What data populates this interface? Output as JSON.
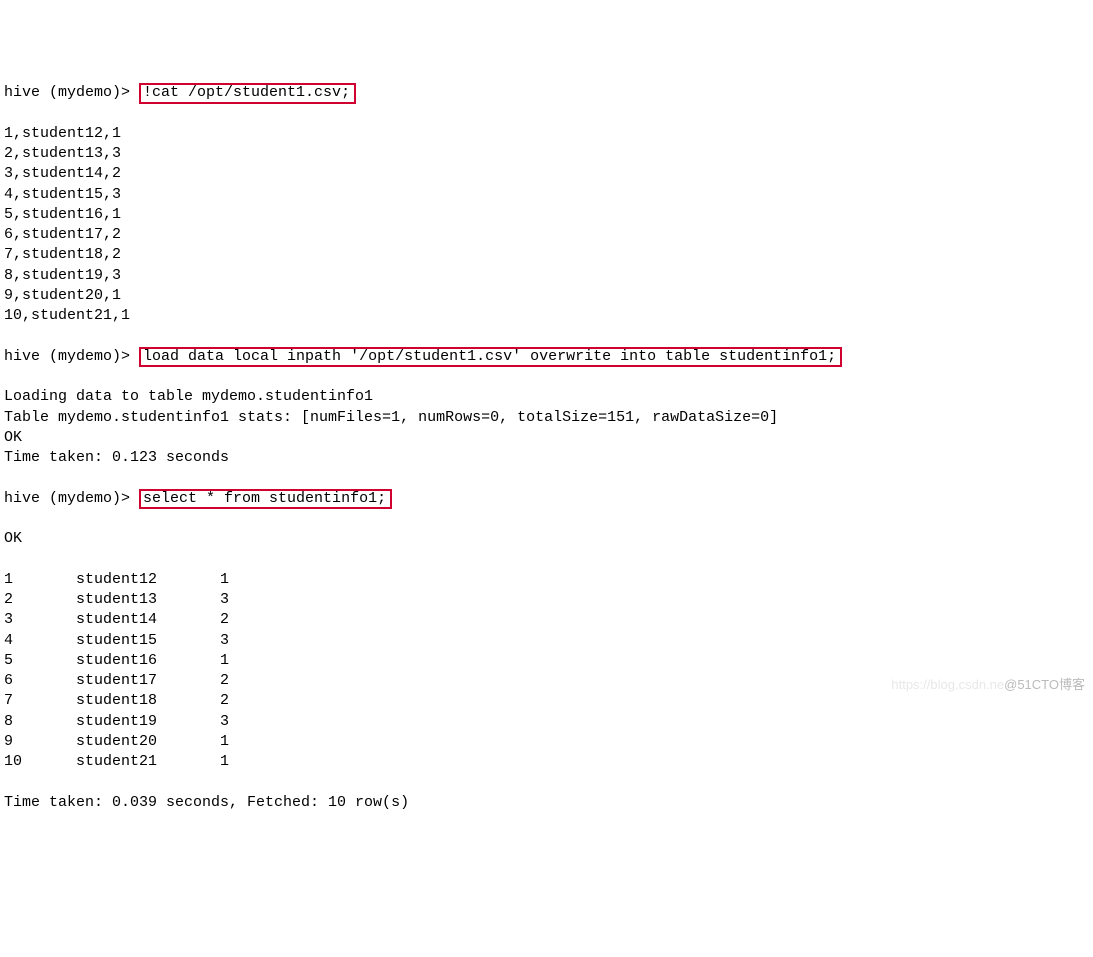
{
  "prompt": "hive (mydemo)> ",
  "cmd1": "!cat /opt/student1.csv;",
  "csv_rows": [
    "1,student12,1",
    "2,student13,3",
    "3,student14,2",
    "4,student15,3",
    "5,student16,1",
    "6,student17,2",
    "7,student18,2",
    "8,student19,3",
    "9,student20,1",
    "10,student21,1"
  ],
  "cmd2": "load data local inpath '/opt/student1.csv' overwrite into table studentinfo1;",
  "load_output": [
    "Loading data to table mydemo.studentinfo1",
    "Table mydemo.studentinfo1 stats: [numFiles=1, numRows=0, totalSize=151, rawDataSize=0]",
    "OK",
    "Time taken: 0.123 seconds"
  ],
  "cmd3": "select * from studentinfo1;",
  "select_ok": "OK",
  "select_rows": [
    {
      "c0": "1",
      "c1": "student12",
      "c2": "1"
    },
    {
      "c0": "2",
      "c1": "student13",
      "c2": "3"
    },
    {
      "c0": "3",
      "c1": "student14",
      "c2": "2"
    },
    {
      "c0": "4",
      "c1": "student15",
      "c2": "3"
    },
    {
      "c0": "5",
      "c1": "student16",
      "c2": "1"
    },
    {
      "c0": "6",
      "c1": "student17",
      "c2": "2"
    },
    {
      "c0": "7",
      "c1": "student18",
      "c2": "2"
    },
    {
      "c0": "8",
      "c1": "student19",
      "c2": "3"
    },
    {
      "c0": "9",
      "c1": "student20",
      "c2": "1"
    },
    {
      "c0": "10",
      "c1": "student21",
      "c2": "1"
    }
  ],
  "final_time": "Time taken: 0.039 seconds, Fetched: 10 row(s)",
  "watermark_left": "https://blog.csdn.ne",
  "watermark_right": "@51CTO博客"
}
